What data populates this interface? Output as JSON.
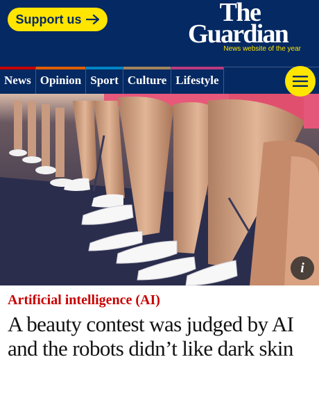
{
  "masthead": {
    "support_label": "Support us",
    "support_icon": "arrow-right-icon",
    "logo_line1": "The",
    "logo_line2": "Guardian",
    "tagline": "News website of the year",
    "background": "#052962",
    "accent": "#ffe500"
  },
  "nav": {
    "items": [
      {
        "label": "News",
        "color": "#c70000"
      },
      {
        "label": "Opinion",
        "color": "#e05e00"
      },
      {
        "label": "Sport",
        "color": "#0084c6"
      },
      {
        "label": "Culture",
        "color": "#a1845c"
      },
      {
        "label": "Lifestyle",
        "color": "#bb3b80"
      }
    ],
    "menu_icon": "hamburger-icon"
  },
  "hero": {
    "image": "photo-of-seated-contestants-in-white-heels",
    "info_label": "i"
  },
  "article": {
    "kicker": "Artificial intelligence (AI)",
    "kicker_color": "#c70000",
    "headline": "A beauty contest was judged by AI and the robots didn’t like dark skin"
  }
}
